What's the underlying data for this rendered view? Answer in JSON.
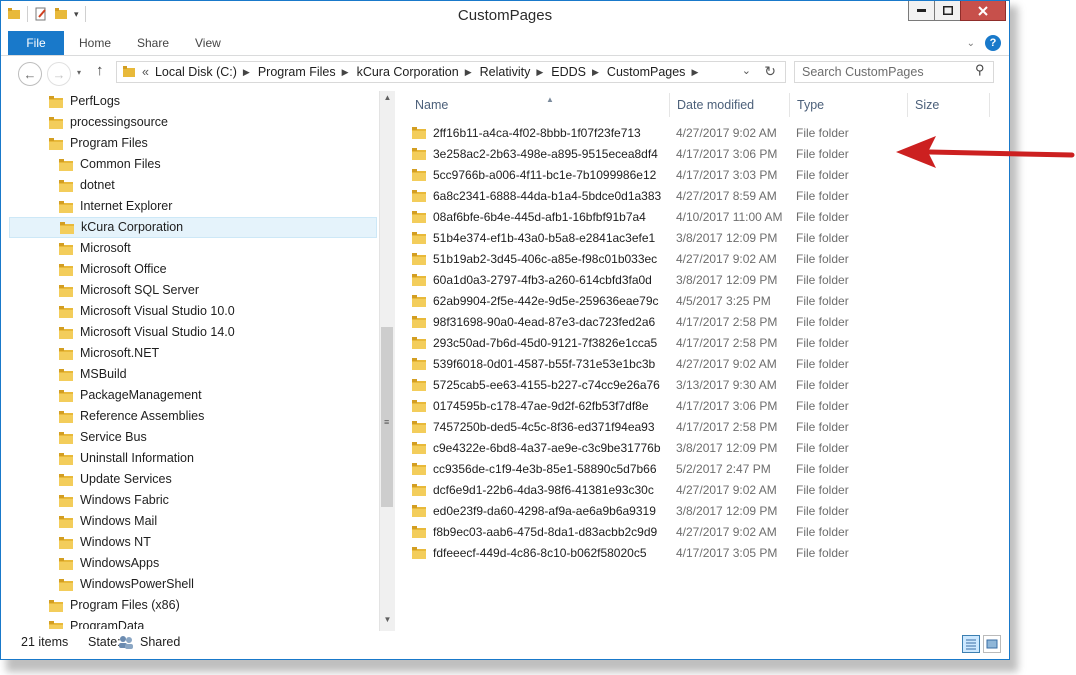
{
  "window": {
    "title": "CustomPages"
  },
  "ribbon": {
    "tabs": [
      "File",
      "Home",
      "Share",
      "View"
    ]
  },
  "address": {
    "prefix": "«",
    "crumbs": [
      "Local Disk (C:)",
      "Program Files",
      "kCura Corporation",
      "Relativity",
      "EDDS",
      "CustomPages"
    ]
  },
  "search": {
    "placeholder": "Search CustomPages"
  },
  "tree": [
    {
      "label": "PerfLogs",
      "level": 0
    },
    {
      "label": "processingsource",
      "level": 0
    },
    {
      "label": "Program Files",
      "level": 0
    },
    {
      "label": "Common Files",
      "level": 1
    },
    {
      "label": "dotnet",
      "level": 1
    },
    {
      "label": "Internet Explorer",
      "level": 1
    },
    {
      "label": "kCura Corporation",
      "level": 1,
      "selected": true
    },
    {
      "label": "Microsoft",
      "level": 1
    },
    {
      "label": "Microsoft Office",
      "level": 1
    },
    {
      "label": "Microsoft SQL Server",
      "level": 1
    },
    {
      "label": "Microsoft Visual Studio 10.0",
      "level": 1
    },
    {
      "label": "Microsoft Visual Studio 14.0",
      "level": 1
    },
    {
      "label": "Microsoft.NET",
      "level": 1
    },
    {
      "label": "MSBuild",
      "level": 1
    },
    {
      "label": "PackageManagement",
      "level": 1
    },
    {
      "label": "Reference Assemblies",
      "level": 1
    },
    {
      "label": "Service Bus",
      "level": 1
    },
    {
      "label": "Uninstall Information",
      "level": 1
    },
    {
      "label": "Update Services",
      "level": 1
    },
    {
      "label": "Windows Fabric",
      "level": 1
    },
    {
      "label": "Windows Mail",
      "level": 1
    },
    {
      "label": "Windows NT",
      "level": 1
    },
    {
      "label": "WindowsApps",
      "level": 1
    },
    {
      "label": "WindowsPowerShell",
      "level": 1
    },
    {
      "label": "Program Files (x86)",
      "level": 0
    },
    {
      "label": "ProgramData",
      "level": 0
    }
  ],
  "columns": [
    "Name",
    "Date modified",
    "Type",
    "Size"
  ],
  "files": [
    {
      "name": "2ff16b11-a4ca-4f02-8bbb-1f07f23fe713",
      "date": "4/27/2017 9:02 AM",
      "type": "File folder"
    },
    {
      "name": "3e258ac2-2b63-498e-a895-9515ecea8df4",
      "date": "4/17/2017 3:06 PM",
      "type": "File folder"
    },
    {
      "name": "5cc9766b-a006-4f11-bc1e-7b1099986e12",
      "date": "4/17/2017 3:03 PM",
      "type": "File folder"
    },
    {
      "name": "6a8c2341-6888-44da-b1a4-5bdce0d1a383",
      "date": "4/27/2017 8:59 AM",
      "type": "File folder"
    },
    {
      "name": "08af6bfe-6b4e-445d-afb1-16bfbf91b7a4",
      "date": "4/10/2017 11:00 AM",
      "type": "File folder"
    },
    {
      "name": "51b4e374-ef1b-43a0-b5a8-e2841ac3efe1",
      "date": "3/8/2017 12:09 PM",
      "type": "File folder"
    },
    {
      "name": "51b19ab2-3d45-406c-a85e-f98c01b033ec",
      "date": "4/27/2017 9:02 AM",
      "type": "File folder"
    },
    {
      "name": "60a1d0a3-2797-4fb3-a260-614cbfd3fa0d",
      "date": "3/8/2017 12:09 PM",
      "type": "File folder"
    },
    {
      "name": "62ab9904-2f5e-442e-9d5e-259636eae79c",
      "date": "4/5/2017 3:25 PM",
      "type": "File folder"
    },
    {
      "name": "98f31698-90a0-4ead-87e3-dac723fed2a6",
      "date": "4/17/2017 2:58 PM",
      "type": "File folder"
    },
    {
      "name": "293c50ad-7b6d-45d0-9121-7f3826e1cca5",
      "date": "4/17/2017 2:58 PM",
      "type": "File folder"
    },
    {
      "name": "539f6018-0d01-4587-b55f-731e53e1bc3b",
      "date": "4/27/2017 9:02 AM",
      "type": "File folder"
    },
    {
      "name": "5725cab5-ee63-4155-b227-c74cc9e26a76",
      "date": "3/13/2017 9:30 AM",
      "type": "File folder"
    },
    {
      "name": "0174595b-c178-47ae-9d2f-62fb53f7df8e",
      "date": "4/17/2017 3:06 PM",
      "type": "File folder"
    },
    {
      "name": "7457250b-ded5-4c5c-8f36-ed371f94ea93",
      "date": "4/17/2017 2:58 PM",
      "type": "File folder"
    },
    {
      "name": "c9e4322e-6bd8-4a37-ae9e-c3c9be31776b",
      "date": "3/8/2017 12:09 PM",
      "type": "File folder"
    },
    {
      "name": "cc9356de-c1f9-4e3b-85e1-58890c5d7b66",
      "date": "5/2/2017 2:47 PM",
      "type": "File folder"
    },
    {
      "name": "dcf6e9d1-22b6-4da3-98f6-41381e93c30c",
      "date": "4/27/2017 9:02 AM",
      "type": "File folder"
    },
    {
      "name": "ed0e23f9-da60-4298-af9a-ae6a9b6a9319",
      "date": "3/8/2017 12:09 PM",
      "type": "File folder"
    },
    {
      "name": "f8b9ec03-aab6-475d-8da1-d83acbb2c9d9",
      "date": "4/27/2017 9:02 AM",
      "type": "File folder"
    },
    {
      "name": "fdfeeecf-449d-4c86-8c10-b062f58020c5",
      "date": "4/17/2017 3:05 PM",
      "type": "File folder"
    }
  ],
  "status": {
    "count": "21 items",
    "state_label": "State:",
    "state_value": "Shared"
  },
  "colors": {
    "accent": "#1979ca",
    "folder": "#e8b93a",
    "annotation_arrow": "#cc2020"
  }
}
